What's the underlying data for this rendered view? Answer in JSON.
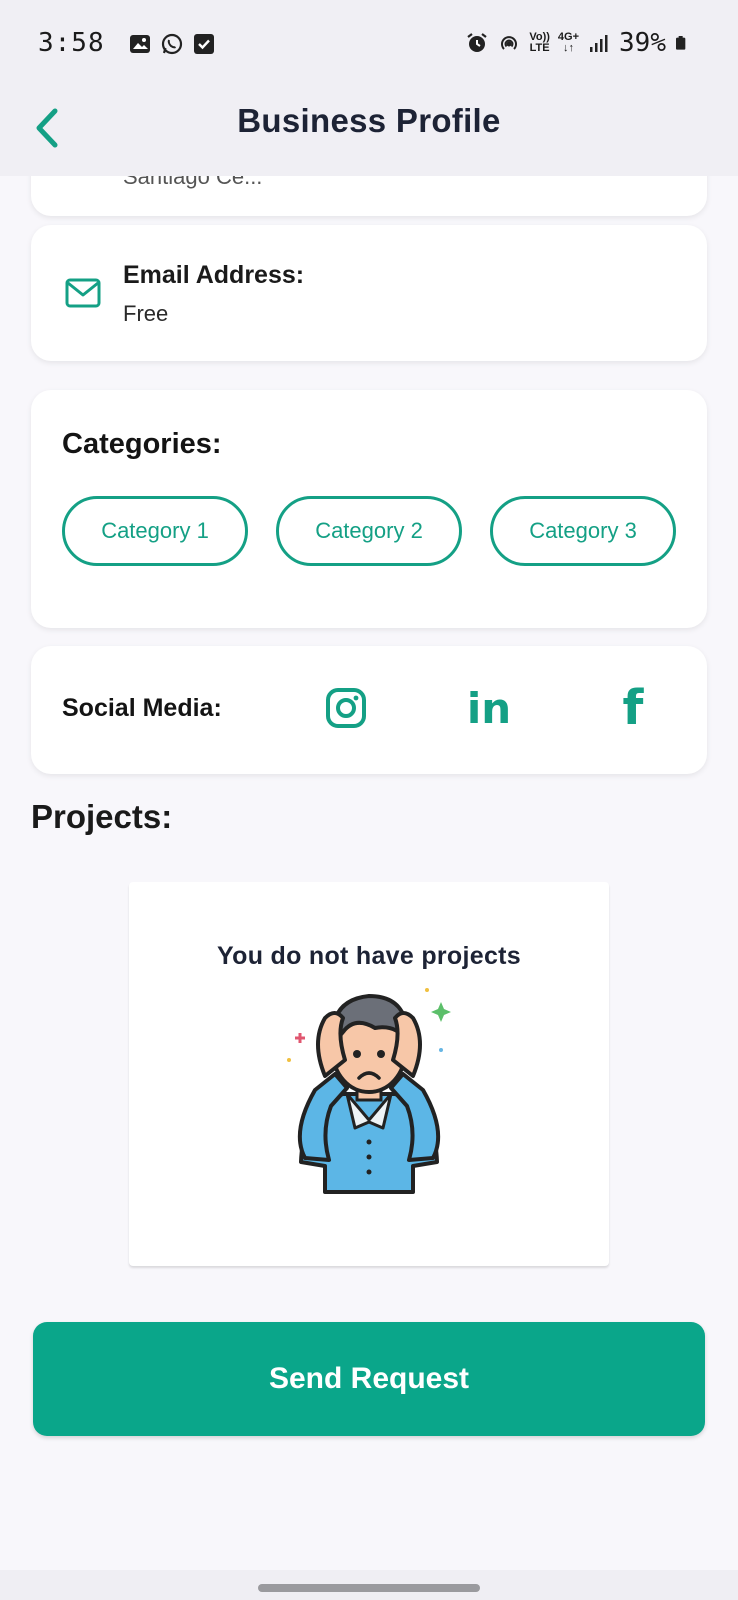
{
  "status_bar": {
    "time": "3:58",
    "battery": "39%",
    "volte_top": "Vo))",
    "volte_bottom": "LTE",
    "net_top": "4G+",
    "net_bottom": "↓↑",
    "left_icons": [
      "gallery-icon",
      "whatsapp-icon",
      "check-square-icon"
    ],
    "right_icons": [
      "alarm-icon",
      "hotspot-icon",
      "signal-icon",
      "battery-icon"
    ]
  },
  "header": {
    "title": "Business Profile",
    "back_icon": "chevron-left-icon"
  },
  "previous_card": {
    "partial_text": "Santiago Ce..."
  },
  "email": {
    "label": "Email Address:",
    "value": "Free",
    "icon": "mail-icon"
  },
  "categories": {
    "title": "Categories:",
    "items": [
      "Category 1",
      "Category 2",
      "Category 3"
    ]
  },
  "social": {
    "label": "Social Media:",
    "instagram_icon": "instagram-icon",
    "linkedin_glyph": "in",
    "facebook_glyph": "f"
  },
  "projects": {
    "title": "Projects:",
    "empty_message": "You do not have projects",
    "illustration": "confused-person-illustration"
  },
  "actions": {
    "send_request": "Send Request"
  },
  "colors": {
    "accent": "#14a085",
    "button": "#0aa68a",
    "title": "#1d2335",
    "background": "#f8f7fb"
  }
}
